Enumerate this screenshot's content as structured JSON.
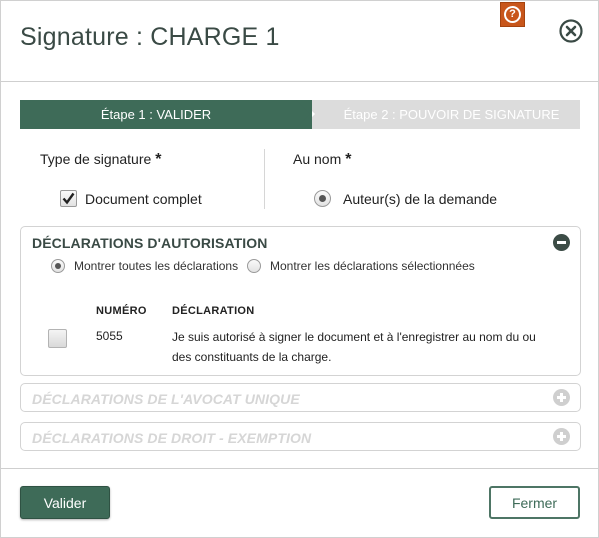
{
  "dialog": {
    "title": "Signature : CHARGE 1",
    "help_icon": "question-mark-icon",
    "close_icon": "close-x-icon"
  },
  "steps": [
    {
      "label": "Étape 1 : VALIDER",
      "active": true
    },
    {
      "label": "Étape 2 : POUVOIR DE SIGNATURE",
      "active": false
    }
  ],
  "signature_type": {
    "label": "Type de signature",
    "required_mark": "*",
    "option_label": "Document complet",
    "checked": true
  },
  "au_nom": {
    "label": "Au nom",
    "required_mark": "*",
    "option_label": "Auteur(s) de la demande",
    "selected": true
  },
  "panels": {
    "declarations_autorisation": {
      "title": "DÉCLARATIONS D'AUTORISATION",
      "expanded": true,
      "filter_all": "Montrer toutes les déclarations",
      "filter_selected": "Montrer les déclarations sélectionnées",
      "filter_value": "all",
      "columns": [
        "NUMÉRO",
        "DÉCLARATION"
      ],
      "rows": [
        {
          "checked": false,
          "numero": "5055",
          "declaration_line1": "Je suis autorisé à signer le document et à l'enregistrer au nom du ou",
          "declaration_line2": "des constituants de la charge."
        }
      ]
    },
    "declarations_avocat": {
      "title": "DÉCLARATIONS DE L'AVOCAT UNIQUE",
      "expanded": false
    },
    "declarations_droit": {
      "title": "DÉCLARATIONS DE DROIT - EXEMPTION",
      "expanded": false
    }
  },
  "footer": {
    "submit_label": "Valider",
    "close_label": "Fermer"
  },
  "colors": {
    "primary_green": "#3e6b58",
    "help_orange": "#c8561b",
    "disabled_gray": "#d6d6d6"
  }
}
